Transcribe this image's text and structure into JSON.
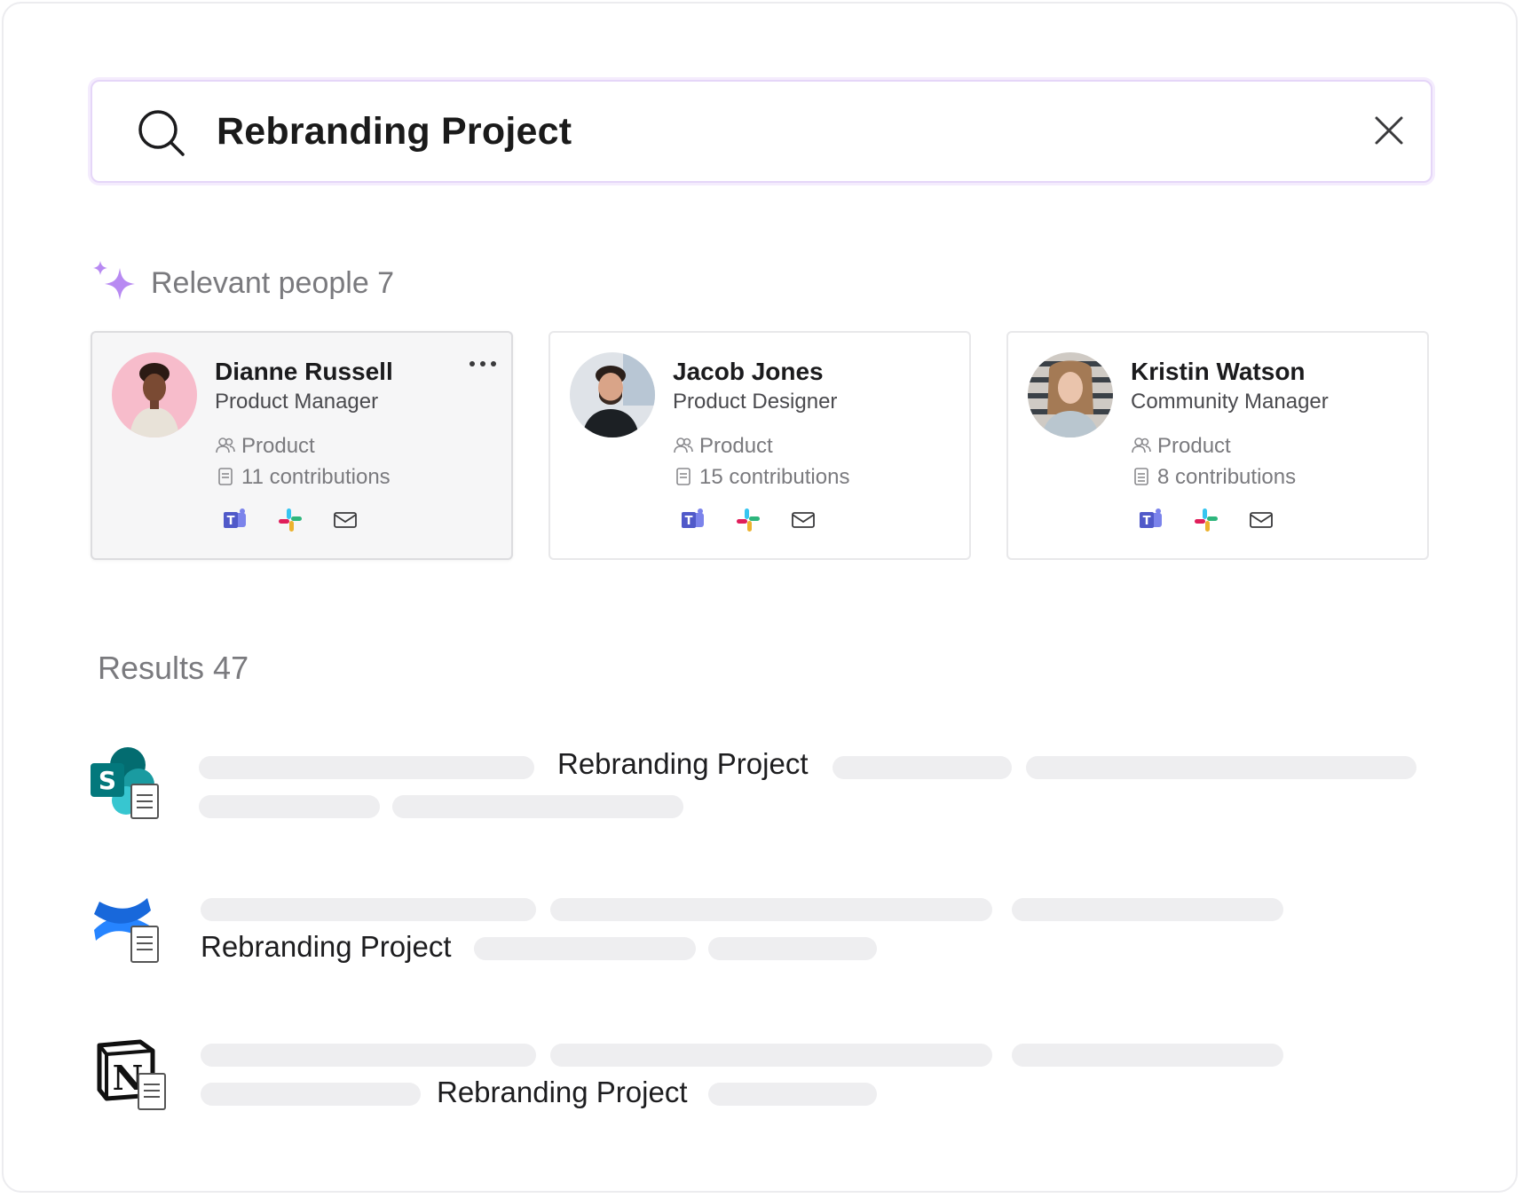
{
  "search": {
    "query": "Rebranding Project",
    "search_icon": "search-icon",
    "clear_icon": "close-icon"
  },
  "people": {
    "title": "Relevant people 7",
    "icon": "sparkle-icon",
    "cards": [
      {
        "name": "Dianne Russell",
        "role": "Product Manager",
        "team": "Product",
        "contributions": "11 contributions",
        "avatar_bg": "#f6b8c5"
      },
      {
        "name": "Jacob Jones",
        "role": "Product Designer",
        "team": "Product",
        "contributions": "15 contributions",
        "avatar_bg": "#d8dde3"
      },
      {
        "name": "Kristin Watson",
        "role": "Community Manager",
        "team": "Product",
        "contributions": "8 contributions",
        "avatar_bg": "#c9c2bb"
      }
    ],
    "apps": [
      "teams-icon",
      "slack-icon",
      "mail-icon"
    ]
  },
  "results": {
    "title": "Results 47",
    "items": [
      {
        "source": "sharepoint-icon",
        "title": "Rebranding Project"
      },
      {
        "source": "confluence-icon",
        "title": "Rebranding Project"
      },
      {
        "source": "notion-icon",
        "title": "Rebranding Project"
      }
    ]
  },
  "colors": {
    "accent": "#b88af2",
    "placeholder_bar": "#eeeef0",
    "teams": "#5059c9",
    "confluence": "#2684ff",
    "sharepoint": "#038387"
  }
}
